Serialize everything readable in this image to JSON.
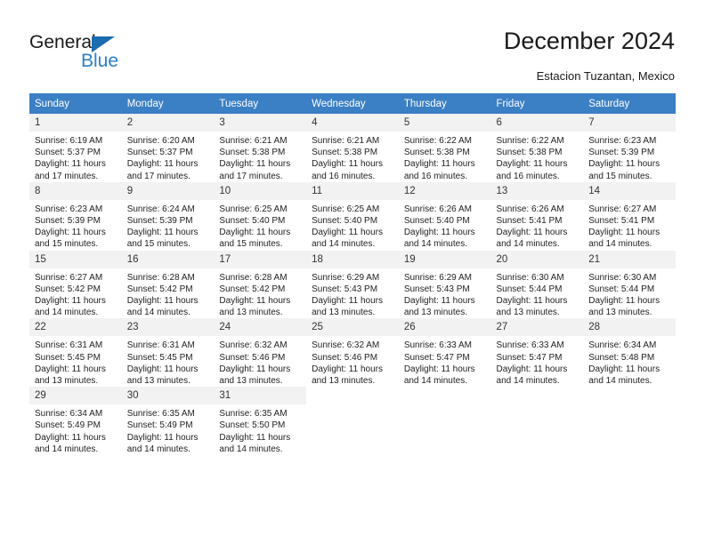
{
  "brand": {
    "name_part1": "General",
    "name_part2": "Blue",
    "accent_color": "#2a7fc9",
    "triangle_color": "#1b6cb0"
  },
  "header": {
    "title": "December 2024",
    "subtitle": "Estacion Tuzantan, Mexico"
  },
  "calendar": {
    "header_bg": "#3b7fc4",
    "daynum_bg": "#f2f2f2",
    "weekdays": [
      "Sunday",
      "Monday",
      "Tuesday",
      "Wednesday",
      "Thursday",
      "Friday",
      "Saturday"
    ],
    "weeks": [
      [
        {
          "day": "1",
          "sunrise": "Sunrise: 6:19 AM",
          "sunset": "Sunset: 5:37 PM",
          "daylight1": "Daylight: 11 hours",
          "daylight2": "and 17 minutes."
        },
        {
          "day": "2",
          "sunrise": "Sunrise: 6:20 AM",
          "sunset": "Sunset: 5:37 PM",
          "daylight1": "Daylight: 11 hours",
          "daylight2": "and 17 minutes."
        },
        {
          "day": "3",
          "sunrise": "Sunrise: 6:21 AM",
          "sunset": "Sunset: 5:38 PM",
          "daylight1": "Daylight: 11 hours",
          "daylight2": "and 17 minutes."
        },
        {
          "day": "4",
          "sunrise": "Sunrise: 6:21 AM",
          "sunset": "Sunset: 5:38 PM",
          "daylight1": "Daylight: 11 hours",
          "daylight2": "and 16 minutes."
        },
        {
          "day": "5",
          "sunrise": "Sunrise: 6:22 AM",
          "sunset": "Sunset: 5:38 PM",
          "daylight1": "Daylight: 11 hours",
          "daylight2": "and 16 minutes."
        },
        {
          "day": "6",
          "sunrise": "Sunrise: 6:22 AM",
          "sunset": "Sunset: 5:38 PM",
          "daylight1": "Daylight: 11 hours",
          "daylight2": "and 16 minutes."
        },
        {
          "day": "7",
          "sunrise": "Sunrise: 6:23 AM",
          "sunset": "Sunset: 5:39 PM",
          "daylight1": "Daylight: 11 hours",
          "daylight2": "and 15 minutes."
        }
      ],
      [
        {
          "day": "8",
          "sunrise": "Sunrise: 6:23 AM",
          "sunset": "Sunset: 5:39 PM",
          "daylight1": "Daylight: 11 hours",
          "daylight2": "and 15 minutes."
        },
        {
          "day": "9",
          "sunrise": "Sunrise: 6:24 AM",
          "sunset": "Sunset: 5:39 PM",
          "daylight1": "Daylight: 11 hours",
          "daylight2": "and 15 minutes."
        },
        {
          "day": "10",
          "sunrise": "Sunrise: 6:25 AM",
          "sunset": "Sunset: 5:40 PM",
          "daylight1": "Daylight: 11 hours",
          "daylight2": "and 15 minutes."
        },
        {
          "day": "11",
          "sunrise": "Sunrise: 6:25 AM",
          "sunset": "Sunset: 5:40 PM",
          "daylight1": "Daylight: 11 hours",
          "daylight2": "and 14 minutes."
        },
        {
          "day": "12",
          "sunrise": "Sunrise: 6:26 AM",
          "sunset": "Sunset: 5:40 PM",
          "daylight1": "Daylight: 11 hours",
          "daylight2": "and 14 minutes."
        },
        {
          "day": "13",
          "sunrise": "Sunrise: 6:26 AM",
          "sunset": "Sunset: 5:41 PM",
          "daylight1": "Daylight: 11 hours",
          "daylight2": "and 14 minutes."
        },
        {
          "day": "14",
          "sunrise": "Sunrise: 6:27 AM",
          "sunset": "Sunset: 5:41 PM",
          "daylight1": "Daylight: 11 hours",
          "daylight2": "and 14 minutes."
        }
      ],
      [
        {
          "day": "15",
          "sunrise": "Sunrise: 6:27 AM",
          "sunset": "Sunset: 5:42 PM",
          "daylight1": "Daylight: 11 hours",
          "daylight2": "and 14 minutes."
        },
        {
          "day": "16",
          "sunrise": "Sunrise: 6:28 AM",
          "sunset": "Sunset: 5:42 PM",
          "daylight1": "Daylight: 11 hours",
          "daylight2": "and 14 minutes."
        },
        {
          "day": "17",
          "sunrise": "Sunrise: 6:28 AM",
          "sunset": "Sunset: 5:42 PM",
          "daylight1": "Daylight: 11 hours",
          "daylight2": "and 13 minutes."
        },
        {
          "day": "18",
          "sunrise": "Sunrise: 6:29 AM",
          "sunset": "Sunset: 5:43 PM",
          "daylight1": "Daylight: 11 hours",
          "daylight2": "and 13 minutes."
        },
        {
          "day": "19",
          "sunrise": "Sunrise: 6:29 AM",
          "sunset": "Sunset: 5:43 PM",
          "daylight1": "Daylight: 11 hours",
          "daylight2": "and 13 minutes."
        },
        {
          "day": "20",
          "sunrise": "Sunrise: 6:30 AM",
          "sunset": "Sunset: 5:44 PM",
          "daylight1": "Daylight: 11 hours",
          "daylight2": "and 13 minutes."
        },
        {
          "day": "21",
          "sunrise": "Sunrise: 6:30 AM",
          "sunset": "Sunset: 5:44 PM",
          "daylight1": "Daylight: 11 hours",
          "daylight2": "and 13 minutes."
        }
      ],
      [
        {
          "day": "22",
          "sunrise": "Sunrise: 6:31 AM",
          "sunset": "Sunset: 5:45 PM",
          "daylight1": "Daylight: 11 hours",
          "daylight2": "and 13 minutes."
        },
        {
          "day": "23",
          "sunrise": "Sunrise: 6:31 AM",
          "sunset": "Sunset: 5:45 PM",
          "daylight1": "Daylight: 11 hours",
          "daylight2": "and 13 minutes."
        },
        {
          "day": "24",
          "sunrise": "Sunrise: 6:32 AM",
          "sunset": "Sunset: 5:46 PM",
          "daylight1": "Daylight: 11 hours",
          "daylight2": "and 13 minutes."
        },
        {
          "day": "25",
          "sunrise": "Sunrise: 6:32 AM",
          "sunset": "Sunset: 5:46 PM",
          "daylight1": "Daylight: 11 hours",
          "daylight2": "and 13 minutes."
        },
        {
          "day": "26",
          "sunrise": "Sunrise: 6:33 AM",
          "sunset": "Sunset: 5:47 PM",
          "daylight1": "Daylight: 11 hours",
          "daylight2": "and 14 minutes."
        },
        {
          "day": "27",
          "sunrise": "Sunrise: 6:33 AM",
          "sunset": "Sunset: 5:47 PM",
          "daylight1": "Daylight: 11 hours",
          "daylight2": "and 14 minutes."
        },
        {
          "day": "28",
          "sunrise": "Sunrise: 6:34 AM",
          "sunset": "Sunset: 5:48 PM",
          "daylight1": "Daylight: 11 hours",
          "daylight2": "and 14 minutes."
        }
      ],
      [
        {
          "day": "29",
          "sunrise": "Sunrise: 6:34 AM",
          "sunset": "Sunset: 5:49 PM",
          "daylight1": "Daylight: 11 hours",
          "daylight2": "and 14 minutes."
        },
        {
          "day": "30",
          "sunrise": "Sunrise: 6:35 AM",
          "sunset": "Sunset: 5:49 PM",
          "daylight1": "Daylight: 11 hours",
          "daylight2": "and 14 minutes."
        },
        {
          "day": "31",
          "sunrise": "Sunrise: 6:35 AM",
          "sunset": "Sunset: 5:50 PM",
          "daylight1": "Daylight: 11 hours",
          "daylight2": "and 14 minutes."
        },
        {
          "day": "",
          "sunrise": "",
          "sunset": "",
          "daylight1": "",
          "daylight2": ""
        },
        {
          "day": "",
          "sunrise": "",
          "sunset": "",
          "daylight1": "",
          "daylight2": ""
        },
        {
          "day": "",
          "sunrise": "",
          "sunset": "",
          "daylight1": "",
          "daylight2": ""
        },
        {
          "day": "",
          "sunrise": "",
          "sunset": "",
          "daylight1": "",
          "daylight2": ""
        }
      ]
    ]
  }
}
